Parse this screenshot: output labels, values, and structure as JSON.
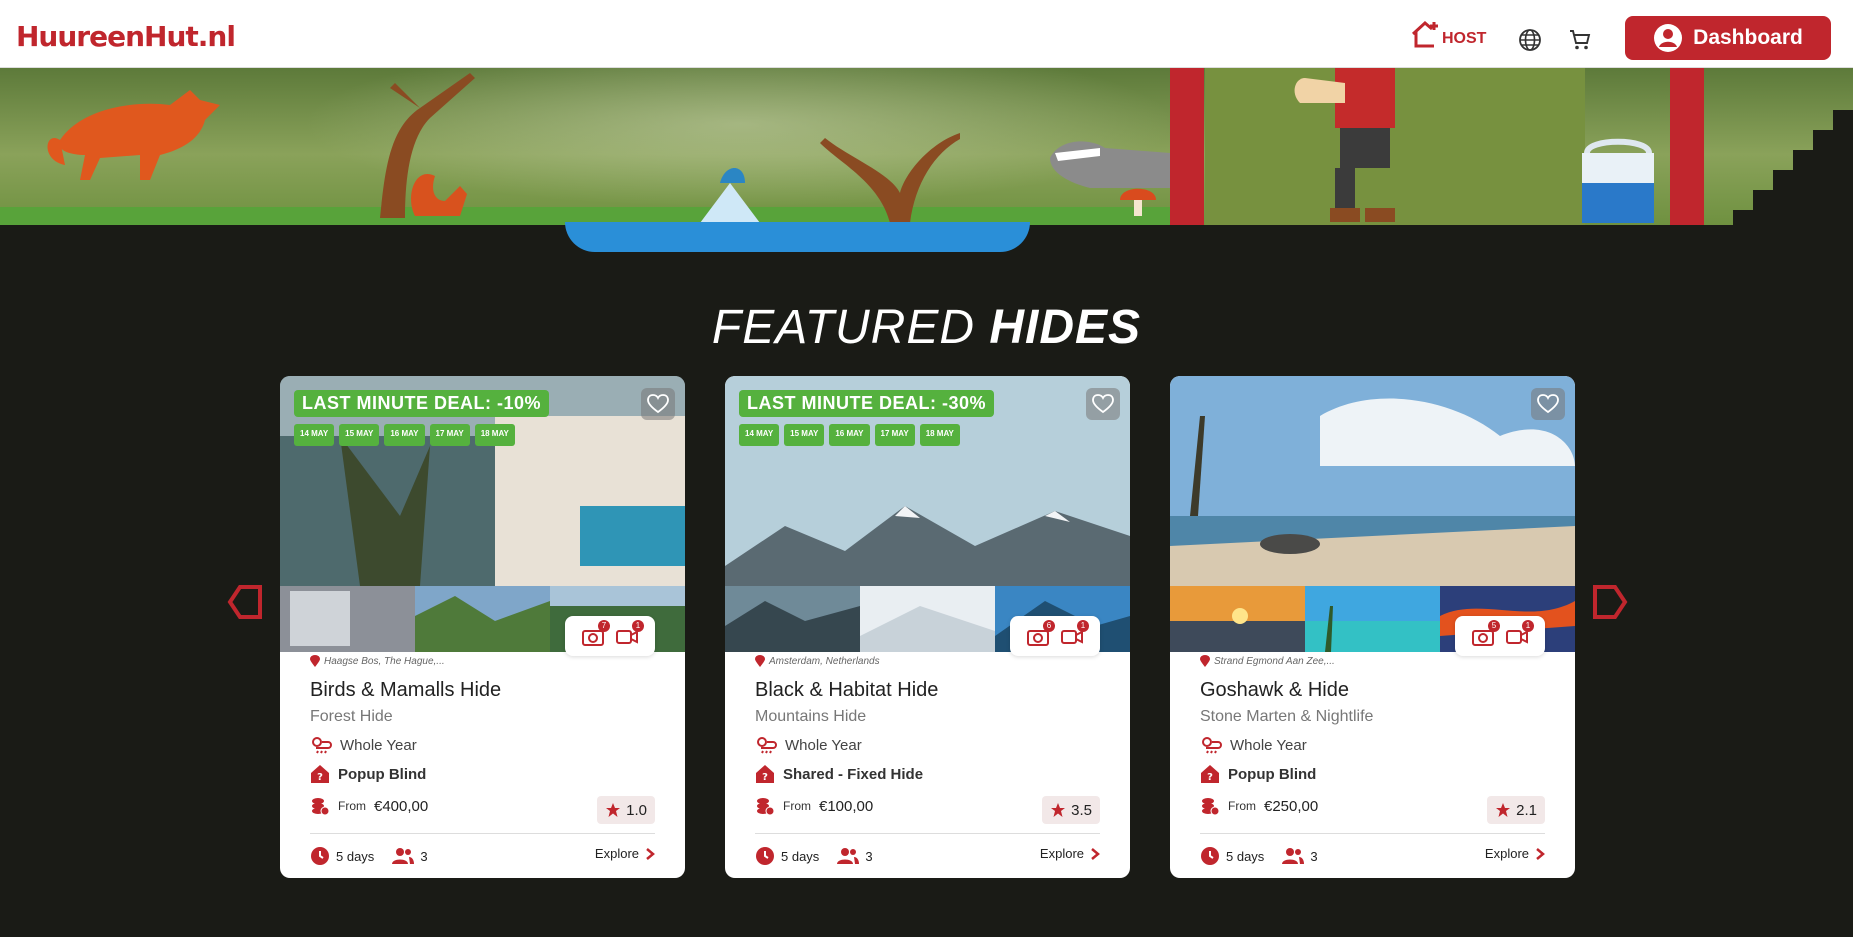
{
  "header": {
    "logo_text": "HuureenHut.nl",
    "host_label": "HOST",
    "dashboard_label": "Dashboard"
  },
  "section": {
    "title_light": "FEATURED",
    "title_bold": "HIDES"
  },
  "colors": {
    "brand_red": "#c0262d",
    "deal_green": "#55b13e",
    "page_dark": "#1a1b16"
  },
  "cards": [
    {
      "deal": "LAST MINUTE DEAL: -10%",
      "dates": [
        "14 MAY",
        "15 MAY",
        "16 MAY",
        "17 MAY",
        "18 MAY"
      ],
      "photo_count": "7",
      "video_count": "1",
      "location": "Haagse Bos, The Hague,...",
      "title": "Birds & Mamalls Hide",
      "subtitle": "Forest Hide",
      "season": "Whole Year",
      "type": "Popup Blind",
      "price_from": "From",
      "price": "€400,00",
      "rating": "1.0",
      "duration": "5 days",
      "people": "3",
      "explore": "Explore"
    },
    {
      "deal": "LAST MINUTE DEAL: -30%",
      "dates": [
        "14 MAY",
        "15 MAY",
        "16 MAY",
        "17 MAY",
        "18 MAY"
      ],
      "photo_count": "6",
      "video_count": "1",
      "location": "Amsterdam, Netherlands",
      "title": "Black & Habitat Hide",
      "subtitle": "Mountains Hide",
      "season": "Whole Year",
      "type": "Shared - Fixed Hide",
      "price_from": "From",
      "price": "€100,00",
      "rating": "3.5",
      "duration": "5 days",
      "people": "3",
      "explore": "Explore"
    },
    {
      "deal": "",
      "dates": [],
      "photo_count": "5",
      "video_count": "1",
      "location": "Strand Egmond Aan Zee,...",
      "title": "Goshawk & Hide",
      "subtitle": "Stone Marten & Nightlife",
      "season": "Whole Year",
      "type": "Popup Blind",
      "price_from": "From",
      "price": "€250,00",
      "rating": "2.1",
      "duration": "5 days",
      "people": "3",
      "explore": "Explore"
    }
  ]
}
